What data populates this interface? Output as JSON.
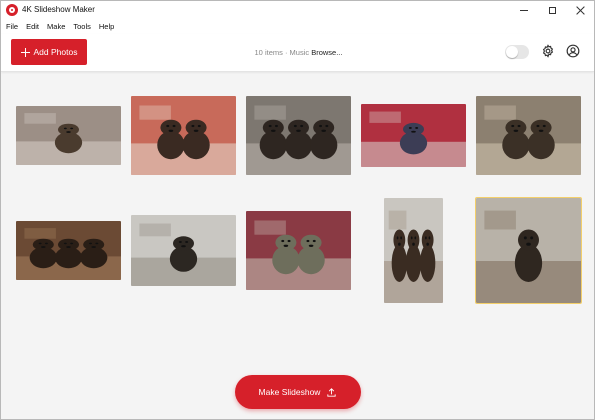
{
  "window": {
    "title": "4K Slideshow Maker"
  },
  "menu": [
    "File",
    "Edit",
    "Make",
    "Tools",
    "Help"
  ],
  "toolbar": {
    "add_photos_label": "Add Photos",
    "status_text": "10 items · Music ",
    "browse_label": "Browse...",
    "toggle_on": false
  },
  "photos": [
    {
      "subject": "dog lying on patterned carpet",
      "palette": [
        "#9c8f86",
        "#4a3b2e",
        "#d8cfc8"
      ]
    },
    {
      "subject": "three dogs on pink blanket",
      "palette": [
        "#c86a5a",
        "#3a2a22",
        "#e8dcd2"
      ]
    },
    {
      "subject": "three dogs on grey floor",
      "palette": [
        "#7d7770",
        "#2e2621",
        "#bdb6ae"
      ]
    },
    {
      "subject": "dogs on red and blue blankets",
      "palette": [
        "#b03040",
        "#3c3d55",
        "#d9d6d0"
      ]
    },
    {
      "subject": "dogs on floral bed",
      "palette": [
        "#8c8070",
        "#3b3026",
        "#d3c6b3"
      ]
    },
    {
      "subject": "two puppies on brown blanket",
      "palette": [
        "#6b4a34",
        "#2a1e16",
        "#a6805e"
      ]
    },
    {
      "subject": "dog on tile floor",
      "palette": [
        "#c9c7c2",
        "#2c2722",
        "#8f8a82"
      ]
    },
    {
      "subject": "dog on red couch",
      "palette": [
        "#8a3a44",
        "#6e6e5c",
        "#c9c4b8"
      ]
    },
    {
      "subject": "dog sitting in corner",
      "palette": [
        "#c9c6c0",
        "#3a2c22",
        "#9a8b7a"
      ]
    },
    {
      "subject": "dog on kitchen floor",
      "palette": [
        "#b8b2a8",
        "#2f2720",
        "#7b6a58"
      ]
    }
  ],
  "selected_index": 9,
  "actions": {
    "make_slideshow_label": "Make Slideshow"
  },
  "colors": {
    "accent": "#d6202a",
    "selection": "#f3cf6a"
  }
}
